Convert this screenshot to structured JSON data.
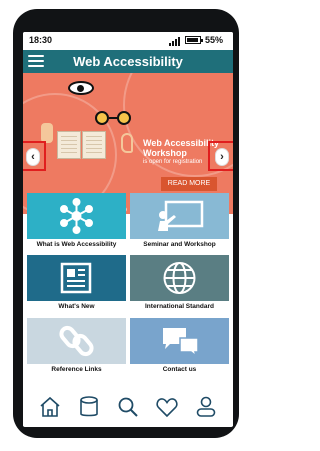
{
  "status": {
    "time": "18:30",
    "battery": "55%"
  },
  "appbar": {
    "title": "Web Accessibility",
    "menu_icon": "hamburger-menu-icon"
  },
  "hero": {
    "title": "Web Accessibility\nWorkshop",
    "subtitle": "is open for registration",
    "cta": "READ MORE",
    "prev_icon": "chevron-left-icon",
    "next_icon": "chevron-right-icon",
    "dot_count": 5,
    "active_dot": 0
  },
  "tiles": [
    {
      "label": "What is Web Accessibility",
      "icon": "network-nodes-icon",
      "color": "#2db0c6"
    },
    {
      "label": "Seminar and Workshop",
      "icon": "presentation-board-icon",
      "color": "#88b9d4"
    },
    {
      "label": "What's New",
      "icon": "newspaper-icon",
      "color": "#1f6b8a"
    },
    {
      "label": "International Standard",
      "icon": "globe-icon",
      "color": "#5a7e83"
    },
    {
      "label": "Reference Links",
      "icon": "chain-link-icon",
      "color": "#c9d7e0"
    },
    {
      "label": "Contact us",
      "icon": "chat-bubbles-icon",
      "color": "#79a4cc"
    }
  ],
  "tabbar": [
    "home-icon",
    "database-icon",
    "search-icon",
    "heart-icon",
    "user-icon"
  ],
  "colors": {
    "appbar": "#1f6f7a",
    "hero": "#ee7a61",
    "highlight": "#e01e1e"
  }
}
